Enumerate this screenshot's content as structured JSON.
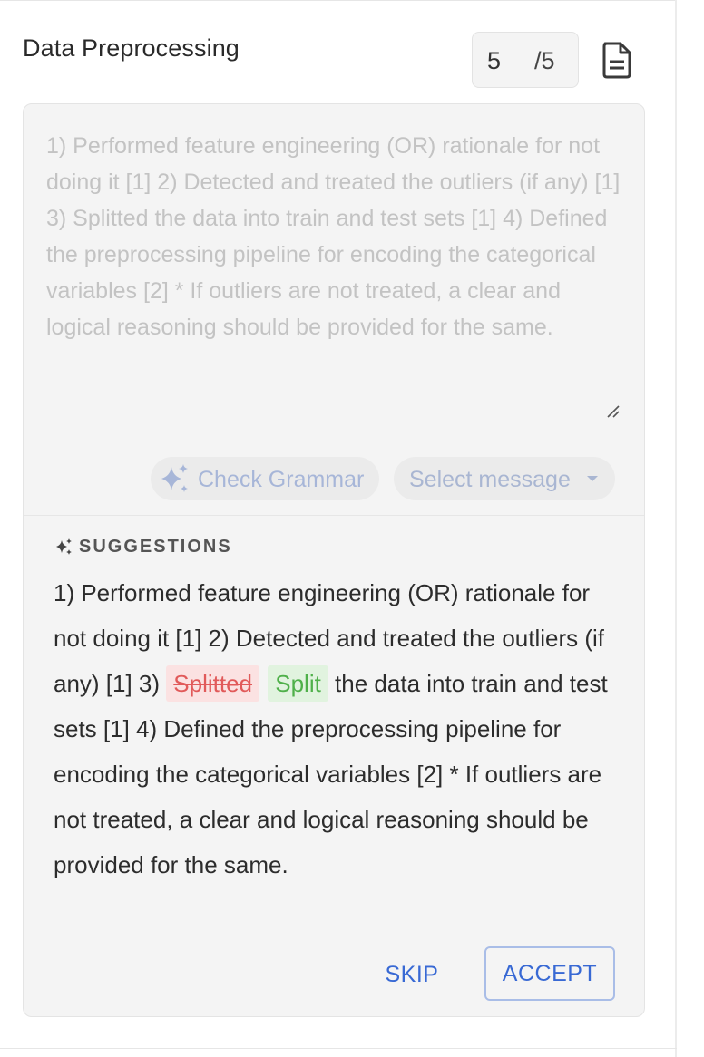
{
  "section": {
    "title": "Data Preprocessing",
    "score_value": "5",
    "score_max": "/5"
  },
  "comment": {
    "value": "",
    "placeholder": "1) Performed feature engineering (OR) rationale for not doing it [1] 2) Detected and treated the outliers (if any) [1] 3) Splitted the data into train and test sets [1] 4) Defined the preprocessing pipeline for encoding the categorical variables [2] * If outliers are not treated, a clear and logical reasoning should be provided for the same."
  },
  "toolbar": {
    "check_grammar_label": "Check Grammar",
    "select_message_label": "Select message"
  },
  "suggestions": {
    "title": "SUGGESTIONS",
    "text_before": "1) Performed feature engineering (OR) rationale for not doing it [1] 2) Detected and treated the outliers (if any) [1] 3) ",
    "removed_word": "Splitted",
    "inserted_word": "Split",
    "text_after": " the data into train and test sets [1] 4) Defined the preprocessing pipeline for encoding the categorical variables [2] * If outliers are not treated, a clear and logical reasoning should be provided for the same."
  },
  "actions": {
    "skip_label": "SKIP",
    "accept_label": "ACCEPT"
  },
  "colors": {
    "accent": "#3869d4",
    "deleted": "#e15a5a",
    "inserted": "#4fb04a",
    "card_background": "#f4f4f4"
  },
  "icons": {
    "document": "document-icon",
    "sparkle": "sparkle-icon",
    "dropdown": "caret-down-icon",
    "resize": "resize-handle-icon"
  }
}
